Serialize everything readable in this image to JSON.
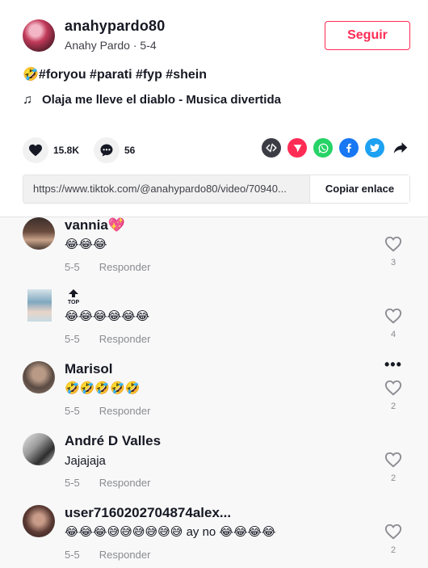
{
  "author": {
    "username": "anahypardo80",
    "subtitle": "Anahy Pardo · 5-4",
    "follow_label": "Seguir"
  },
  "post": {
    "caption": "🤣#foryou #parati #fyp #shein",
    "music": "Olaja me lleve el diablo - Musica divertida"
  },
  "stats": {
    "likes": "15.8K",
    "comments": "56"
  },
  "share_icons": [
    "embed-icon",
    "send-icon",
    "whatsapp-icon",
    "facebook-icon",
    "twitter-icon",
    "share-arrow-icon"
  ],
  "link": {
    "url": "https://www.tiktok.com/@anahypardo80/video/70940...",
    "copy_label": "Copiar enlace"
  },
  "comments": [
    {
      "user": "vannia💖",
      "text": "😂😂😂",
      "date": "5-5",
      "reply": "Responder",
      "likes": "3"
    },
    {
      "user": "",
      "badge": "TOP",
      "text": "😂😂😂😂😂😂",
      "date": "5-5",
      "reply": "Responder",
      "likes": "4"
    },
    {
      "user": "Marisol",
      "text": "🤣🤣🤣🤣🤣",
      "date": "5-5",
      "reply": "Responder",
      "likes": "2"
    },
    {
      "user": "André D Valles",
      "text": "Jajajaja",
      "date": "5-5",
      "reply": "Responder",
      "likes": "2"
    },
    {
      "user": "user7160202704874alex...",
      "text": "😂😂😂😅😅😅😅😅😅 ay no 😂😂😂😂",
      "date": "5-5",
      "reply": "Responder",
      "likes": "2"
    }
  ],
  "colors": {
    "accent": "#fe2c55",
    "whatsapp": "#25d366",
    "facebook": "#1877f2",
    "twitter": "#1da1f2",
    "embed": "#3b3c44"
  }
}
